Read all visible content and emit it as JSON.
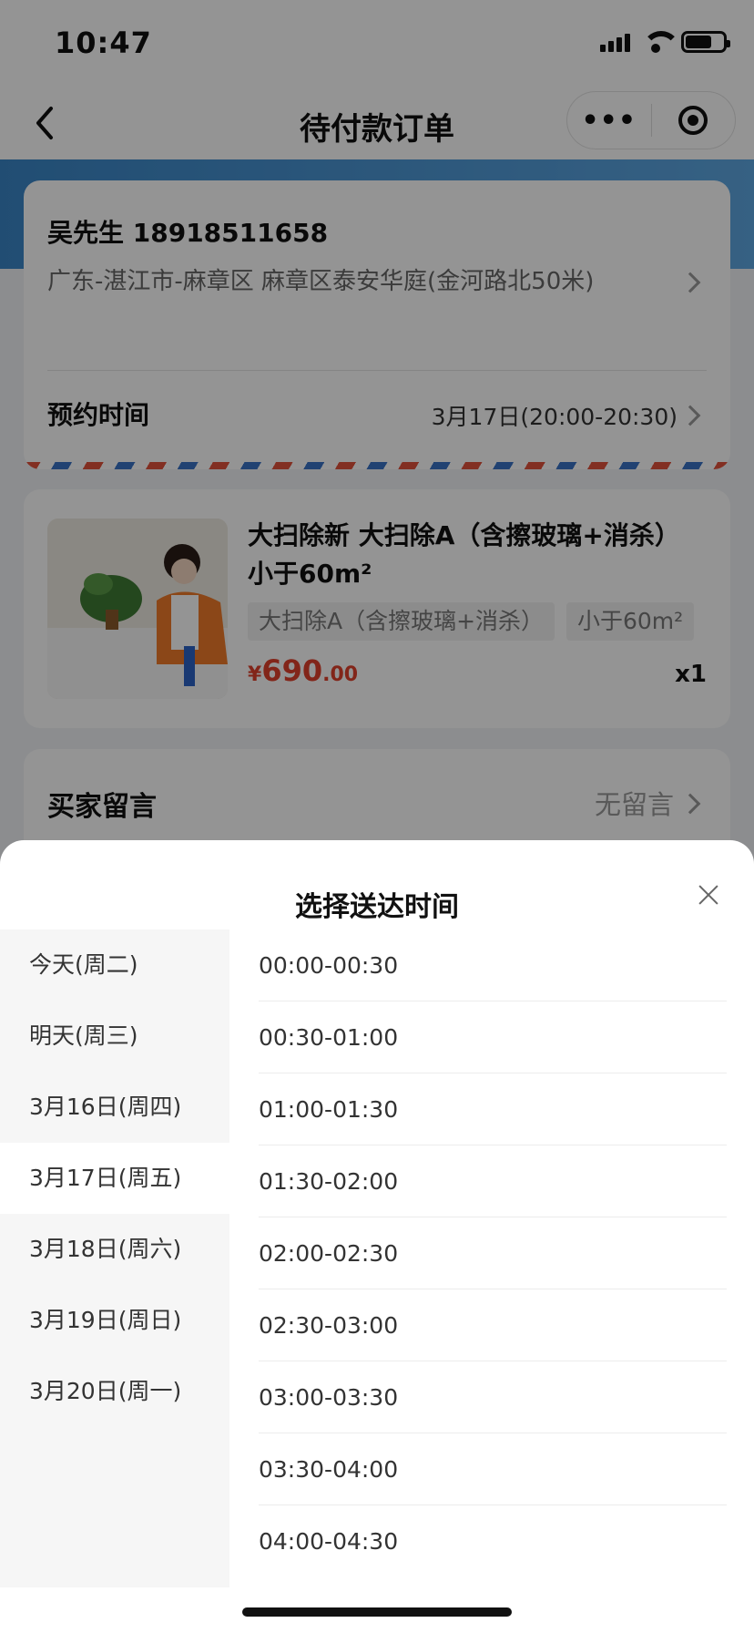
{
  "status_bar": {
    "time": "10:47"
  },
  "nav": {
    "title": "待付款订单",
    "more": "•••"
  },
  "address": {
    "name_phone": "吴先生 18918511658",
    "address": "广东-湛江市-麻章区 麻章区泰安华庭(金河路北50米)",
    "appointment_label": "预约时间",
    "appointment_value": "3月17日(20:00-20:30)"
  },
  "product": {
    "title": "大扫除新 大扫除A（含擦玻璃+消杀）小于60m²",
    "tags": [
      "大扫除A（含擦玻璃+消杀）",
      "小于60m²"
    ],
    "price_currency": "¥",
    "price_int": "690",
    "price_dec": ".00",
    "quantity": "x1"
  },
  "message": {
    "label": "买家留言",
    "value": "无留言"
  },
  "sheet": {
    "title": "选择送达时间",
    "dates": [
      {
        "label": "今天(周二)",
        "active": false
      },
      {
        "label": "明天(周三)",
        "active": false
      },
      {
        "label": "3月16日(周四)",
        "active": false
      },
      {
        "label": "3月17日(周五)",
        "active": true
      },
      {
        "label": "3月18日(周六)",
        "active": false
      },
      {
        "label": "3月19日(周日)",
        "active": false
      },
      {
        "label": "3月20日(周一)",
        "active": false
      }
    ],
    "slots": [
      "00:00-00:30",
      "00:30-01:00",
      "01:00-01:30",
      "01:30-02:00",
      "02:00-02:30",
      "02:30-03:00",
      "03:00-03:30",
      "03:30-04:00",
      "04:00-04:30"
    ]
  },
  "colors": {
    "price": "#e0412c",
    "header_blue": "#3a86c7",
    "overlay": "rgba(0,0,0,0.42)"
  }
}
